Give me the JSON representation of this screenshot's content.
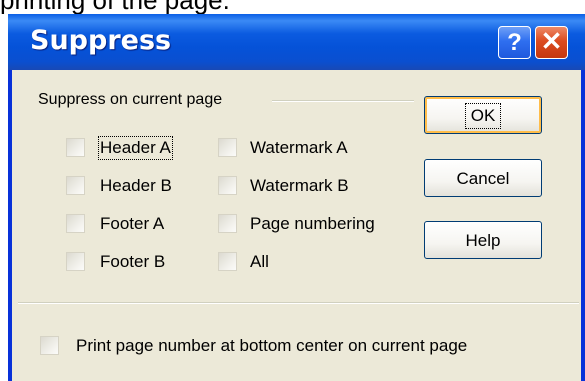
{
  "caption": "printing of the page.",
  "dialog": {
    "title": "Suppress",
    "help_glyph": "?",
    "close_glyph": "✕"
  },
  "group": {
    "label": "Suppress on current page",
    "checkboxes": [
      {
        "id": "header-a",
        "text": "Header A",
        "checked": false
      },
      {
        "id": "header-b",
        "text": "Header B",
        "checked": false
      },
      {
        "id": "footer-a",
        "text": "Footer A",
        "checked": false
      },
      {
        "id": "footer-b",
        "text": "Footer B",
        "checked": false
      },
      {
        "id": "watermark-a",
        "text": "Watermark A",
        "checked": false
      },
      {
        "id": "watermark-b",
        "text": "Watermark B",
        "checked": false
      },
      {
        "id": "page-numbering",
        "text": "Page numbering",
        "checked": false
      },
      {
        "id": "all",
        "text": "All",
        "checked": false
      }
    ]
  },
  "print_option": {
    "text": "Print page number at bottom center on current page",
    "checked": false
  },
  "buttons": {
    "ok": "OK",
    "cancel": "Cancel",
    "help": "Help"
  },
  "colors": {
    "titlebar": "#0a5fe6",
    "face": "#ece9d8",
    "close": "#dc4b20",
    "default_button_ring": "#ffbd4a"
  }
}
